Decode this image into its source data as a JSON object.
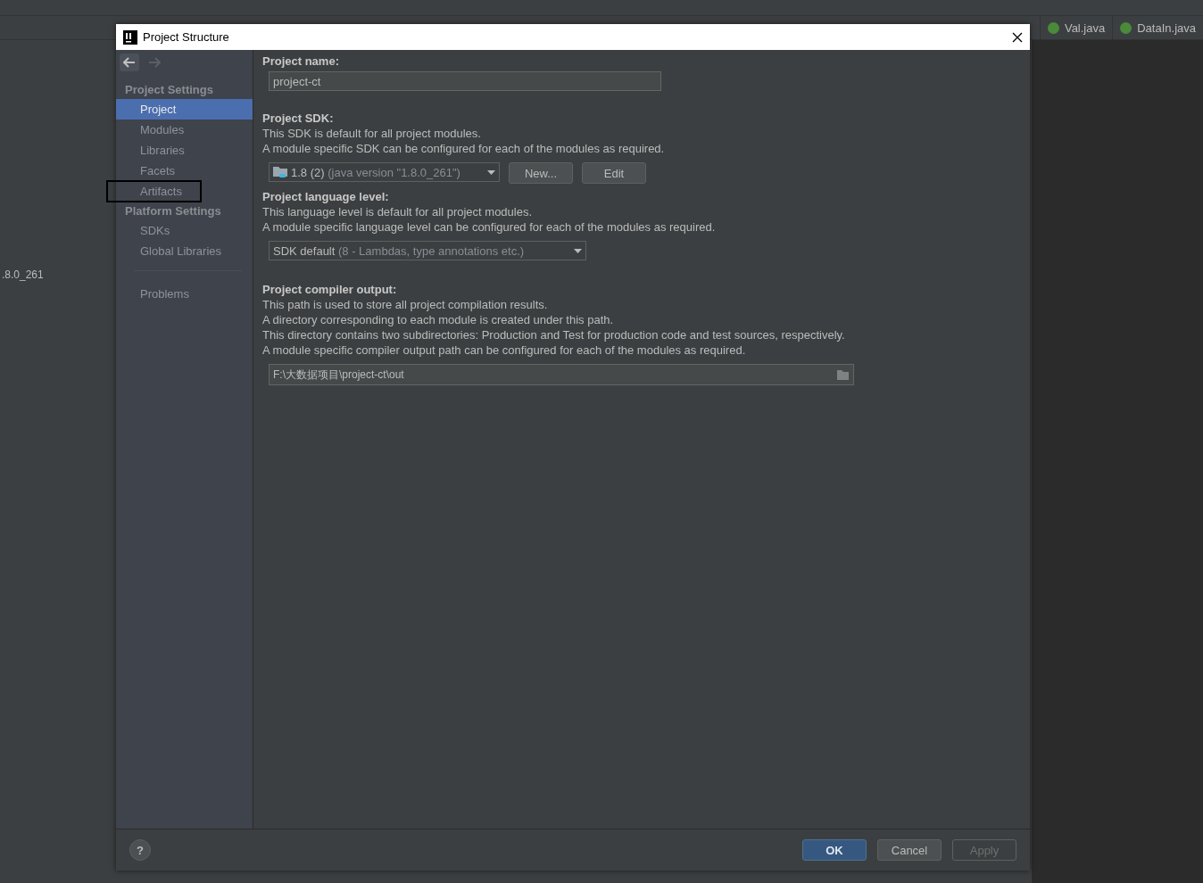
{
  "ide": {
    "editor_tabs": [
      {
        "label": "Val.java",
        "selected": false
      },
      {
        "label": "DataIn.java",
        "selected": false
      }
    ],
    "side_text": ".8.0_261"
  },
  "dialog": {
    "title": "Project Structure",
    "sidebar": {
      "sections": [
        {
          "title": "Project Settings",
          "items": [
            {
              "label": "Project",
              "selected": true,
              "outlined": false
            },
            {
              "label": "Modules",
              "selected": false,
              "outlined": false
            },
            {
              "label": "Libraries",
              "selected": false,
              "outlined": false
            },
            {
              "label": "Facets",
              "selected": false,
              "outlined": false
            },
            {
              "label": "Artifacts",
              "selected": false,
              "outlined": true
            }
          ]
        },
        {
          "title": "Platform Settings",
          "items": [
            {
              "label": "SDKs",
              "selected": false,
              "outlined": false
            },
            {
              "label": "Global Libraries",
              "selected": false,
              "outlined": false
            }
          ]
        }
      ],
      "footer_items": [
        {
          "label": "Problems",
          "selected": false,
          "outlined": false
        }
      ]
    },
    "project_name": {
      "label": "Project name:",
      "value": "project-ct"
    },
    "sdk": {
      "label": "Project SDK:",
      "lines": [
        "This SDK is default for all project modules.",
        "A module specific SDK can be configured for each of the modules as required."
      ],
      "select": {
        "value": "1.8 (2)",
        "detail": "(java version \"1.8.0_261\")"
      },
      "buttons": [
        {
          "label": "New...",
          "disabled": false
        },
        {
          "label": "Edit",
          "disabled": false
        }
      ]
    },
    "language": {
      "label": "Project language level:",
      "lines": [
        "This language level is default for all project modules.",
        "A module specific language level can be configured for each of the modules as required."
      ],
      "select": {
        "value": "SDK default",
        "detail": "(8 - Lambdas, type annotations etc.)"
      }
    },
    "compiler": {
      "label": "Project compiler output:",
      "lines": [
        "This path is used to store all project compilation results.",
        "A directory corresponding to each module is created under this path.",
        "This directory contains two subdirectories: Production and Test for production code and test sources, respectively.",
        "A module specific compiler output path can be configured for each of the modules as required."
      ],
      "path": "F:\\大数据项目\\project-ct\\out"
    },
    "help": "?",
    "buttons": [
      {
        "label": "OK",
        "kind": "primary",
        "disabled": false
      },
      {
        "label": "Cancel",
        "kind": "default",
        "disabled": false
      },
      {
        "label": "Apply",
        "kind": "default",
        "disabled": true
      }
    ]
  }
}
